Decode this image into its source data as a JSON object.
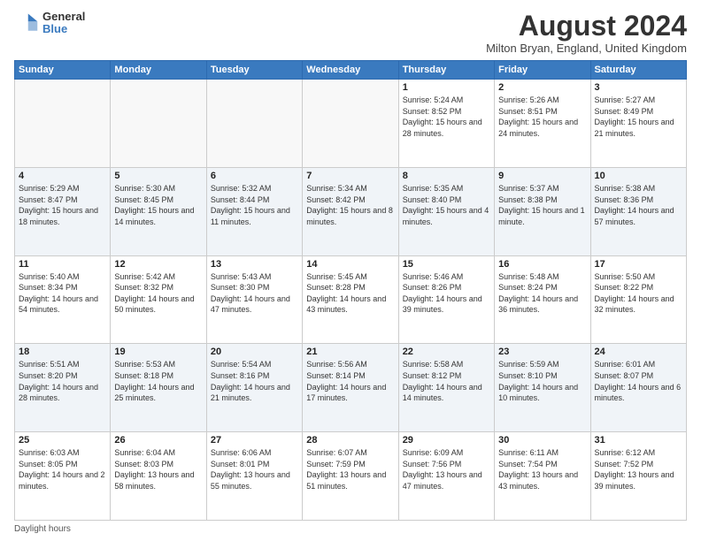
{
  "logo": {
    "general": "General",
    "blue": "Blue"
  },
  "title": "August 2024",
  "location": "Milton Bryan, England, United Kingdom",
  "days_of_week": [
    "Sunday",
    "Monday",
    "Tuesday",
    "Wednesday",
    "Thursday",
    "Friday",
    "Saturday"
  ],
  "footer": "Daylight hours",
  "weeks": [
    [
      {
        "day": "",
        "info": ""
      },
      {
        "day": "",
        "info": ""
      },
      {
        "day": "",
        "info": ""
      },
      {
        "day": "",
        "info": ""
      },
      {
        "day": "1",
        "info": "Sunrise: 5:24 AM\nSunset: 8:52 PM\nDaylight: 15 hours and 28 minutes."
      },
      {
        "day": "2",
        "info": "Sunrise: 5:26 AM\nSunset: 8:51 PM\nDaylight: 15 hours and 24 minutes."
      },
      {
        "day": "3",
        "info": "Sunrise: 5:27 AM\nSunset: 8:49 PM\nDaylight: 15 hours and 21 minutes."
      }
    ],
    [
      {
        "day": "4",
        "info": "Sunrise: 5:29 AM\nSunset: 8:47 PM\nDaylight: 15 hours and 18 minutes."
      },
      {
        "day": "5",
        "info": "Sunrise: 5:30 AM\nSunset: 8:45 PM\nDaylight: 15 hours and 14 minutes."
      },
      {
        "day": "6",
        "info": "Sunrise: 5:32 AM\nSunset: 8:44 PM\nDaylight: 15 hours and 11 minutes."
      },
      {
        "day": "7",
        "info": "Sunrise: 5:34 AM\nSunset: 8:42 PM\nDaylight: 15 hours and 8 minutes."
      },
      {
        "day": "8",
        "info": "Sunrise: 5:35 AM\nSunset: 8:40 PM\nDaylight: 15 hours and 4 minutes."
      },
      {
        "day": "9",
        "info": "Sunrise: 5:37 AM\nSunset: 8:38 PM\nDaylight: 15 hours and 1 minute."
      },
      {
        "day": "10",
        "info": "Sunrise: 5:38 AM\nSunset: 8:36 PM\nDaylight: 14 hours and 57 minutes."
      }
    ],
    [
      {
        "day": "11",
        "info": "Sunrise: 5:40 AM\nSunset: 8:34 PM\nDaylight: 14 hours and 54 minutes."
      },
      {
        "day": "12",
        "info": "Sunrise: 5:42 AM\nSunset: 8:32 PM\nDaylight: 14 hours and 50 minutes."
      },
      {
        "day": "13",
        "info": "Sunrise: 5:43 AM\nSunset: 8:30 PM\nDaylight: 14 hours and 47 minutes."
      },
      {
        "day": "14",
        "info": "Sunrise: 5:45 AM\nSunset: 8:28 PM\nDaylight: 14 hours and 43 minutes."
      },
      {
        "day": "15",
        "info": "Sunrise: 5:46 AM\nSunset: 8:26 PM\nDaylight: 14 hours and 39 minutes."
      },
      {
        "day": "16",
        "info": "Sunrise: 5:48 AM\nSunset: 8:24 PM\nDaylight: 14 hours and 36 minutes."
      },
      {
        "day": "17",
        "info": "Sunrise: 5:50 AM\nSunset: 8:22 PM\nDaylight: 14 hours and 32 minutes."
      }
    ],
    [
      {
        "day": "18",
        "info": "Sunrise: 5:51 AM\nSunset: 8:20 PM\nDaylight: 14 hours and 28 minutes."
      },
      {
        "day": "19",
        "info": "Sunrise: 5:53 AM\nSunset: 8:18 PM\nDaylight: 14 hours and 25 minutes."
      },
      {
        "day": "20",
        "info": "Sunrise: 5:54 AM\nSunset: 8:16 PM\nDaylight: 14 hours and 21 minutes."
      },
      {
        "day": "21",
        "info": "Sunrise: 5:56 AM\nSunset: 8:14 PM\nDaylight: 14 hours and 17 minutes."
      },
      {
        "day": "22",
        "info": "Sunrise: 5:58 AM\nSunset: 8:12 PM\nDaylight: 14 hours and 14 minutes."
      },
      {
        "day": "23",
        "info": "Sunrise: 5:59 AM\nSunset: 8:10 PM\nDaylight: 14 hours and 10 minutes."
      },
      {
        "day": "24",
        "info": "Sunrise: 6:01 AM\nSunset: 8:07 PM\nDaylight: 14 hours and 6 minutes."
      }
    ],
    [
      {
        "day": "25",
        "info": "Sunrise: 6:03 AM\nSunset: 8:05 PM\nDaylight: 14 hours and 2 minutes."
      },
      {
        "day": "26",
        "info": "Sunrise: 6:04 AM\nSunset: 8:03 PM\nDaylight: 13 hours and 58 minutes."
      },
      {
        "day": "27",
        "info": "Sunrise: 6:06 AM\nSunset: 8:01 PM\nDaylight: 13 hours and 55 minutes."
      },
      {
        "day": "28",
        "info": "Sunrise: 6:07 AM\nSunset: 7:59 PM\nDaylight: 13 hours and 51 minutes."
      },
      {
        "day": "29",
        "info": "Sunrise: 6:09 AM\nSunset: 7:56 PM\nDaylight: 13 hours and 47 minutes."
      },
      {
        "day": "30",
        "info": "Sunrise: 6:11 AM\nSunset: 7:54 PM\nDaylight: 13 hours and 43 minutes."
      },
      {
        "day": "31",
        "info": "Sunrise: 6:12 AM\nSunset: 7:52 PM\nDaylight: 13 hours and 39 minutes."
      }
    ]
  ]
}
